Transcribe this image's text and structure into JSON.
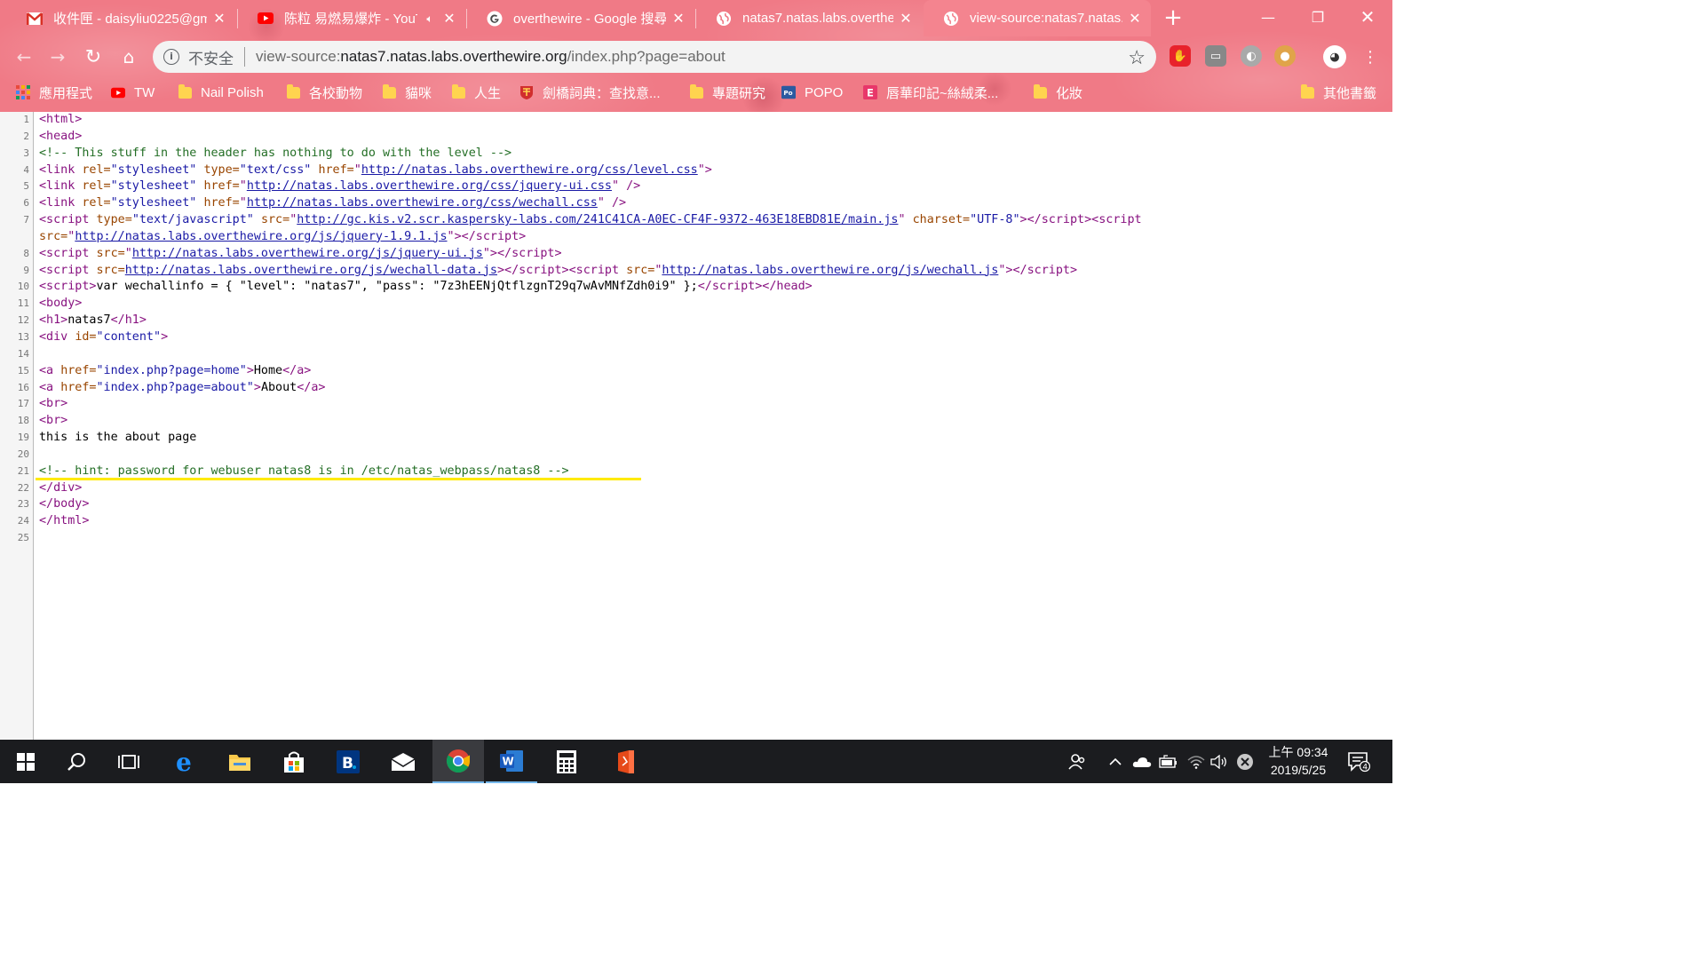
{
  "tabs": [
    {
      "title": "收件匣 - daisyliu0225@gm",
      "favicon": "gmail-icon",
      "active": false
    },
    {
      "title": "陈粒 易燃易爆炸 - YouT",
      "favicon": "youtube-icon",
      "active": false,
      "audio": true
    },
    {
      "title": "overthewire - Google 搜尋",
      "favicon": "google-icon",
      "active": false
    },
    {
      "title": "natas7.natas.labs.overthew",
      "favicon": "globe-icon",
      "active": false
    },
    {
      "title": "view-source:natas7.natas.",
      "favicon": "globe-icon",
      "active": true
    }
  ],
  "toolbar": {
    "security_label": "不安全",
    "url_scheme": "view-source:",
    "url_host": "natas7.natas.labs.overthewire.org",
    "url_path": "/index.php?page=about"
  },
  "bookmarks": [
    {
      "label": "應用程式",
      "icon": "apps-grid-icon"
    },
    {
      "label": "TW",
      "icon": "youtube-icon"
    },
    {
      "label": "Nail Polish",
      "icon": "folder-icon"
    },
    {
      "label": "各校動物",
      "icon": "folder-icon"
    },
    {
      "label": "貓咪",
      "icon": "folder-icon"
    },
    {
      "label": "人生",
      "icon": "folder-icon"
    },
    {
      "label": "劍橋詞典：查找意...",
      "icon": "cambridge-icon"
    },
    {
      "label": "專題研究",
      "icon": "folder-icon"
    },
    {
      "label": "POPO",
      "icon": "popo-icon"
    },
    {
      "label": "唇華印記~絲絨柔...",
      "icon": "e-icon"
    },
    {
      "label": "化妝",
      "icon": "folder-icon"
    },
    {
      "label": "其他書籤",
      "icon": "folder-icon"
    }
  ],
  "source": {
    "line_numbers": [
      "1",
      "2",
      "3",
      "4",
      "5",
      "6",
      "7",
      "8",
      "9",
      "10",
      "11",
      "12",
      "13",
      "14",
      "15",
      "16",
      "17",
      "18",
      "19",
      "20",
      "21",
      "22",
      "23",
      "24",
      "25"
    ],
    "l1": "<html>",
    "l2": "<head>",
    "l3": "<!-- This stuff in the header has nothing to do with the level -->",
    "l4_tag": "<link rel=",
    "l4_rel": "\"stylesheet\"",
    "l4_type_attr": " type=",
    "l4_type": "\"text/css\"",
    "l4_href_attr": " href=",
    "l4_url": "http://natas.labs.overthewire.org/css/level.css",
    "l5_url": "http://natas.labs.overthewire.org/css/jquery-ui.css",
    "l6_url": "http://natas.labs.overthewire.org/css/wechall.css",
    "l7_url1": "http://gc.kis.v2.scr.kaspersky-labs.com/241C41CA-A0EC-CF4F-9372-463E18EBD81E/main.js",
    "l7_charset": "\"UTF-8\"",
    "l7_url2": "http://natas.labs.overthewire.org/js/jquery-1.9.1.js",
    "l8_url": "http://natas.labs.overthewire.org/js/jquery-ui.js",
    "l9_url1": "http://natas.labs.overthewire.org/js/wechall-data.js",
    "l9_url2": "http://natas.labs.overthewire.org/js/wechall.js",
    "l10_text": "var wechallinfo = { \"level\": \"natas7\", \"pass\": \"7z3hEENjQtflzgnT29q7wAvMNfZdh0i9\" };",
    "l11": "<body>",
    "l12_text": "natas7",
    "l13_val": "\"content\"",
    "l15_href": "\"index.php?page=home\"",
    "l15_text": "Home",
    "l16_href": "\"index.php?page=about\"",
    "l16_text": "About",
    "l17": "<br>",
    "l18": "<br>",
    "l19": "this is the about page",
    "l21": "<!-- hint: password for webuser natas8 is in /etc/natas_webpass/natas8 -->",
    "l22": "</div>",
    "l23": "</body>",
    "l24": "</html>"
  },
  "taskbar": {
    "clock_time": "上午 09:34",
    "clock_date": "2019/5/25",
    "notification_count": "4"
  },
  "colors": {
    "chrome_pink": "#f07a86",
    "highlight_yellow": "#ffea00",
    "tag_purple": "#881280",
    "attr_brown": "#994500",
    "value_blue": "#1a1aa6",
    "comment_green": "#236e25"
  }
}
